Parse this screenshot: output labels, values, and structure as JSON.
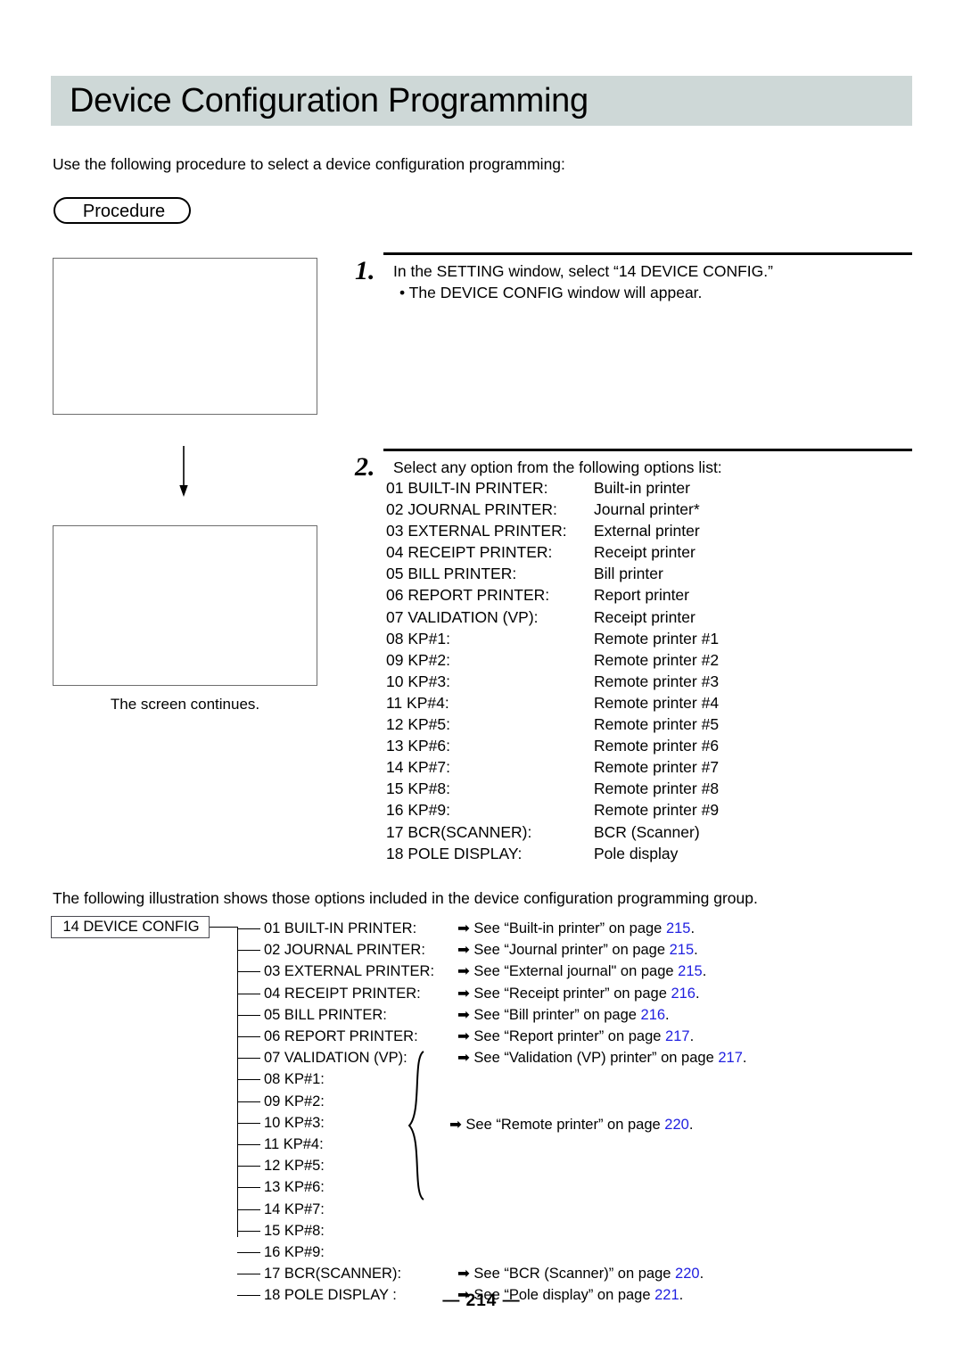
{
  "page": {
    "title": "Device Configuration Programming",
    "intro": "Use the following procedure to select a device configuration programming:",
    "procedure_label": "Procedure",
    "screen_continues": "The screen continues.",
    "illustration_intro": "The following illustration shows those options included in the device configuration programming group.",
    "footer": "— 214 —"
  },
  "steps": [
    {
      "number": "1.",
      "main": "In the SETTING window, select “14 DEVICE CONFIG.”",
      "sub": "• The DEVICE CONFIG window will appear."
    },
    {
      "number": "2.",
      "main": "Select any option from the following options list:"
    }
  ],
  "options": [
    {
      "code": "01 BUILT-IN PRINTER:",
      "desc": "Built-in printer"
    },
    {
      "code": "02 JOURNAL PRINTER:",
      "desc": "Journal printer*"
    },
    {
      "code": "03 EXTERNAL PRINTER:",
      "desc": "External printer"
    },
    {
      "code": "04 RECEIPT PRINTER:",
      "desc": "Receipt printer"
    },
    {
      "code": "05 BILL PRINTER:",
      "desc": "Bill printer"
    },
    {
      "code": "06 REPORT PRINTER:",
      "desc": "Report printer"
    },
    {
      "code": "07 VALIDATION (VP):",
      "desc": "Receipt printer"
    },
    {
      "code": "08 KP#1:",
      "desc": "Remote printer #1"
    },
    {
      "code": "09 KP#2:",
      "desc": "Remote printer #2"
    },
    {
      "code": "10 KP#3:",
      "desc": "Remote printer #3"
    },
    {
      "code": "11 KP#4:",
      "desc": "Remote printer #4"
    },
    {
      "code": "12 KP#5:",
      "desc": "Remote printer #5"
    },
    {
      "code": "13 KP#6:",
      "desc": "Remote printer #6"
    },
    {
      "code": "14 KP#7:",
      "desc": "Remote printer #7"
    },
    {
      "code": "15 KP#8:",
      "desc": "Remote printer #8"
    },
    {
      "code": "16 KP#9:",
      "desc": "Remote printer #9"
    },
    {
      "code": "17 BCR(SCANNER):",
      "desc": "BCR (Scanner)"
    },
    {
      "code": "18 POLE DISPLAY:",
      "desc": "Pole display"
    }
  ],
  "tree": {
    "root_label": "14 DEVICE CONFIG",
    "arrow_glyph": "➡",
    "link_color": "#1f1fe0",
    "grouped_ref": {
      "prefix": "➡ See “Remote printer” on page ",
      "page": "220",
      "suffix": "."
    },
    "rows": [
      {
        "option": "01 BUILT-IN PRINTER:",
        "ref_prefix": "➡ See “Built-in printer” on page ",
        "page": "215",
        "ref_suffix": "."
      },
      {
        "option": "02 JOURNAL PRINTER:",
        "ref_prefix": "➡ See “Journal printer” on page ",
        "page": "215",
        "ref_suffix": "."
      },
      {
        "option": "03 EXTERNAL PRINTER:",
        "ref_prefix": "➡ See “External journal\" on page ",
        "page": "215",
        "ref_suffix": "."
      },
      {
        "option": "04 RECEIPT PRINTER:",
        "ref_prefix": "➡ See “Receipt printer” on page ",
        "page": "216",
        "ref_suffix": "."
      },
      {
        "option": "05 BILL PRINTER:",
        "ref_prefix": "➡ See “Bill printer” on page ",
        "page": "216",
        "ref_suffix": "."
      },
      {
        "option": "06 REPORT PRINTER:",
        "ref_prefix": "➡ See “Report printer” on page ",
        "page": "217",
        "ref_suffix": "."
      },
      {
        "option": "07 VALIDATION (VP):",
        "ref_prefix": "➡ See “Validation (VP) printer” on page ",
        "page": "217",
        "ref_suffix": "."
      },
      {
        "option": "08 KP#1:",
        "ref_prefix": "",
        "page": "",
        "ref_suffix": ""
      },
      {
        "option": "09 KP#2:",
        "ref_prefix": "",
        "page": "",
        "ref_suffix": ""
      },
      {
        "option": "10 KP#3:",
        "ref_prefix": "",
        "page": "",
        "ref_suffix": ""
      },
      {
        "option": "11 KP#4:",
        "ref_prefix": "",
        "page": "",
        "ref_suffix": ""
      },
      {
        "option": "12 KP#5:",
        "ref_prefix": "",
        "page": "",
        "ref_suffix": ""
      },
      {
        "option": "13 KP#6:",
        "ref_prefix": "",
        "page": "",
        "ref_suffix": ""
      },
      {
        "option": "14 KP#7:",
        "ref_prefix": "",
        "page": "",
        "ref_suffix": ""
      },
      {
        "option": "15 KP#8:",
        "ref_prefix": "",
        "page": "",
        "ref_suffix": ""
      },
      {
        "option": "16 KP#9:",
        "ref_prefix": "",
        "page": "",
        "ref_suffix": ""
      },
      {
        "option": "17 BCR(SCANNER):",
        "ref_prefix": "➡ See “BCR (Scanner)” on page ",
        "page": "220",
        "ref_suffix": "."
      },
      {
        "option": "18 POLE DISPLAY :",
        "ref_prefix": "➡ See “Pole display” on page ",
        "page": "221",
        "ref_suffix": "."
      }
    ]
  }
}
